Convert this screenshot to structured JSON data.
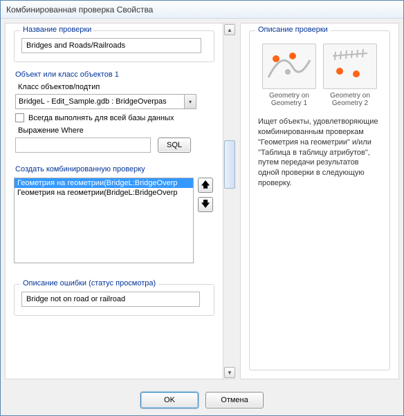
{
  "window": {
    "title": "Комбинированная проверка Свойства"
  },
  "left": {
    "check_name": {
      "label": "Название проверки",
      "value": "Bridges and Roads/Railroads"
    },
    "object_class": {
      "title": "Объект или класс объектов 1",
      "class_label": "Класс объектов/подтип",
      "combo_value": "BridgeL - Edit_Sample.gdb : BridgeOverpas",
      "always_run_label": "Всегда выполнять для всей базы данных",
      "where_label": "Выражение Where",
      "where_value": "",
      "sql_button": "SQL"
    },
    "combined": {
      "title": "Создать комбинированную проверку",
      "items": [
        "Геометрия на геометрии(BridgeL:BridgeOverp",
        "Геометрия на геометрии(BridgeL:BridgeOverp"
      ]
    },
    "error": {
      "label": "Описание ошибки (статус просмотра)",
      "value": "Bridge not on road or railroad"
    }
  },
  "right": {
    "title": "Описание проверки",
    "thumbs": [
      {
        "caption_l1": "Geometry on",
        "caption_l2": "Geometry 1"
      },
      {
        "caption_l1": "Geometry on",
        "caption_l2": "Geometry 2"
      }
    ],
    "description": "Ищет объекты, удовлетворяющие комбинированным проверкам \"Геометрия на геометрии\" и/или \"Таблица в таблицу атрибутов\", путем передачи результатов одной проверки в следующую проверку."
  },
  "footer": {
    "ok": "OK",
    "cancel": "Отмена"
  }
}
